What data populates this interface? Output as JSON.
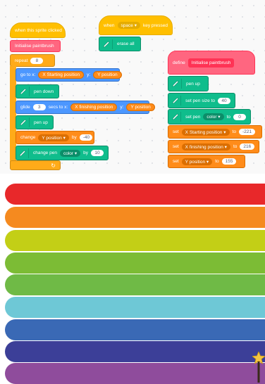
{
  "script_green_flag": {
    "hat_label": "when this sprite clicked",
    "init_call": "Initialise paintbrush",
    "repeat_label": "repeat",
    "repeat_count": "8",
    "goto": {
      "prefix": "go to x:",
      "x_var": "X Starting position",
      "y_label": "y:",
      "y_var": "Y position"
    },
    "pen_down": "pen down",
    "glide": {
      "prefix": "glide",
      "secs": "3",
      "middle": "secs to x:",
      "x_var": "X finishing position",
      "y_label": "y:",
      "y_var": "Y position"
    },
    "pen_up": "pen up",
    "change_var": {
      "prefix": "change",
      "var": "Y position",
      "by_label": "by",
      "value": "-40"
    },
    "change_pen": {
      "prefix": "change pen",
      "param": "color",
      "by_label": "by",
      "value": "10"
    }
  },
  "script_space": {
    "hat_prefix": "when",
    "key": "space",
    "hat_suffix": "key pressed",
    "erase_all": "erase all"
  },
  "script_define": {
    "define_label": "define",
    "define_name": "Initialise paintbrush",
    "pen_up": "pen up",
    "set_size": {
      "label": "set pen size to",
      "value": "40"
    },
    "set_color": {
      "prefix": "set pen",
      "param": "color",
      "to_label": "to",
      "value": "0"
    },
    "set_vars": [
      {
        "label": "set",
        "var": "X Starting position",
        "to_label": "to",
        "value": "-221"
      },
      {
        "label": "set",
        "var": "X finishing position",
        "to_label": "to",
        "value": "216"
      },
      {
        "label": "set",
        "var": "Y position",
        "to_label": "to",
        "value": "155"
      }
    ]
  },
  "stage": {
    "stripe_colors": [
      "#e8282a",
      "#f58a1f",
      "#c3cf16",
      "#7cbc35",
      "#6fba46",
      "#6ec8d6",
      "#3a69b5",
      "#3c3f98",
      "#8f4c9c"
    ]
  },
  "colors": {
    "events": "#ffbf00",
    "control": "#ffab19",
    "motion": "#4c97ff",
    "variables": "#ff8c1a",
    "pen": "#0fbd8c",
    "my_blocks": "#ff6680"
  }
}
